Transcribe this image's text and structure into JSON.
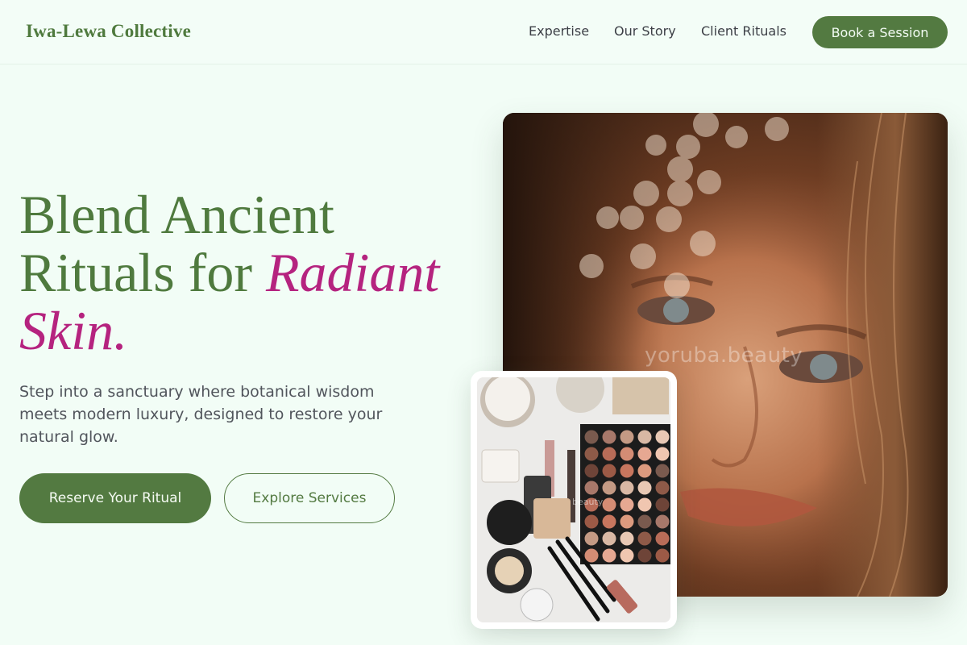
{
  "header": {
    "brand": "Iwa-Lewa Collective",
    "nav": [
      "Expertise",
      "Our Story",
      "Client Rituals"
    ],
    "cta": "Book a Session"
  },
  "hero": {
    "headline_part1": "Blend Ancient Rituals for ",
    "headline_accent": "Radiant Skin.",
    "subtext": "Step into a sanctuary where botanical wisdom meets modern luxury, designed to restore your natural glow.",
    "primary_button": "Reserve Your Ritual",
    "secondary_button": "Explore Services"
  },
  "images": {
    "portrait_watermark": "yoruba.beauty",
    "makeup_watermark": "beauty"
  },
  "colors": {
    "brand_green": "#537a41",
    "accent_magenta": "#b5237f",
    "background": "#f2fdf6"
  }
}
